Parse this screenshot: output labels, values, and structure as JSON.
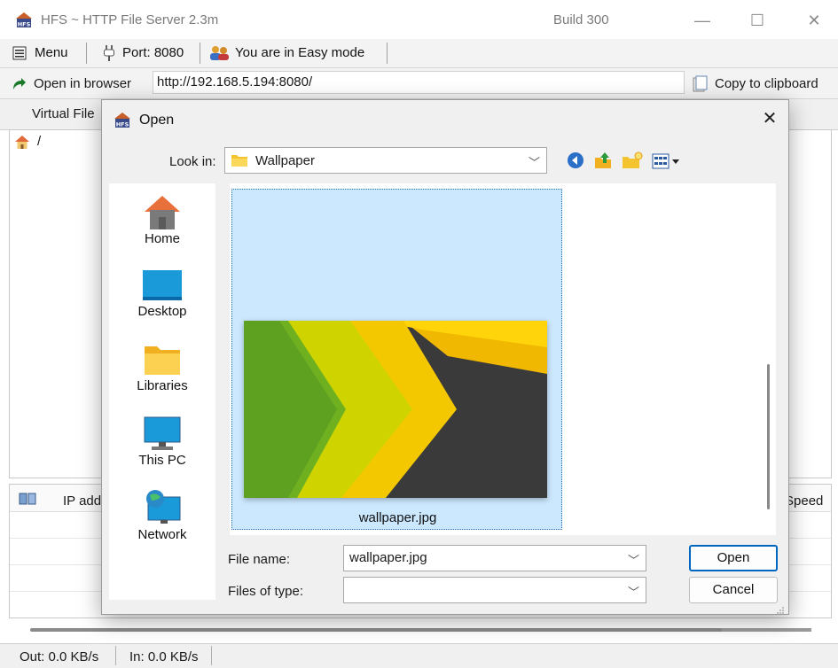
{
  "window": {
    "title": "HFS ~ HTTP File Server 2.3m",
    "build": "Build 300",
    "controls": {
      "minimize": "—",
      "maximize": "☐",
      "close": "✕"
    }
  },
  "toolbar": {
    "menu_label": "Menu",
    "port_label": "Port: 8080",
    "mode_label": "You are in Easy mode"
  },
  "urlbar": {
    "open_in_browser_label": "Open in browser",
    "url": "http://192.168.5.194:8080/",
    "copy_label": "Copy to clipboard"
  },
  "vfs": {
    "tab_label": "Virtual File",
    "root_label": "/"
  },
  "connections": {
    "ip_header": "IP addre",
    "speed_header": "Speed"
  },
  "statusbar": {
    "out_label": "Out: 0.0 KB/s",
    "in_label": "In: 0.0 KB/s"
  },
  "dialog": {
    "title": "Open",
    "look_in_label": "Look in:",
    "look_in_value": "Wallpaper",
    "places": [
      "Home",
      "Desktop",
      "Libraries",
      "This PC",
      "Network"
    ],
    "file_item_name": "wallpaper.jpg",
    "file_name_label": "File name:",
    "file_name_value": "wallpaper.jpg",
    "files_of_type_label": "Files of type:",
    "files_of_type_value": "",
    "open_button": "Open",
    "cancel_button": "Cancel"
  },
  "colors": {
    "selection": "#cce8ff",
    "selection_border": "#2a6fba",
    "accent": "#0067c0"
  }
}
